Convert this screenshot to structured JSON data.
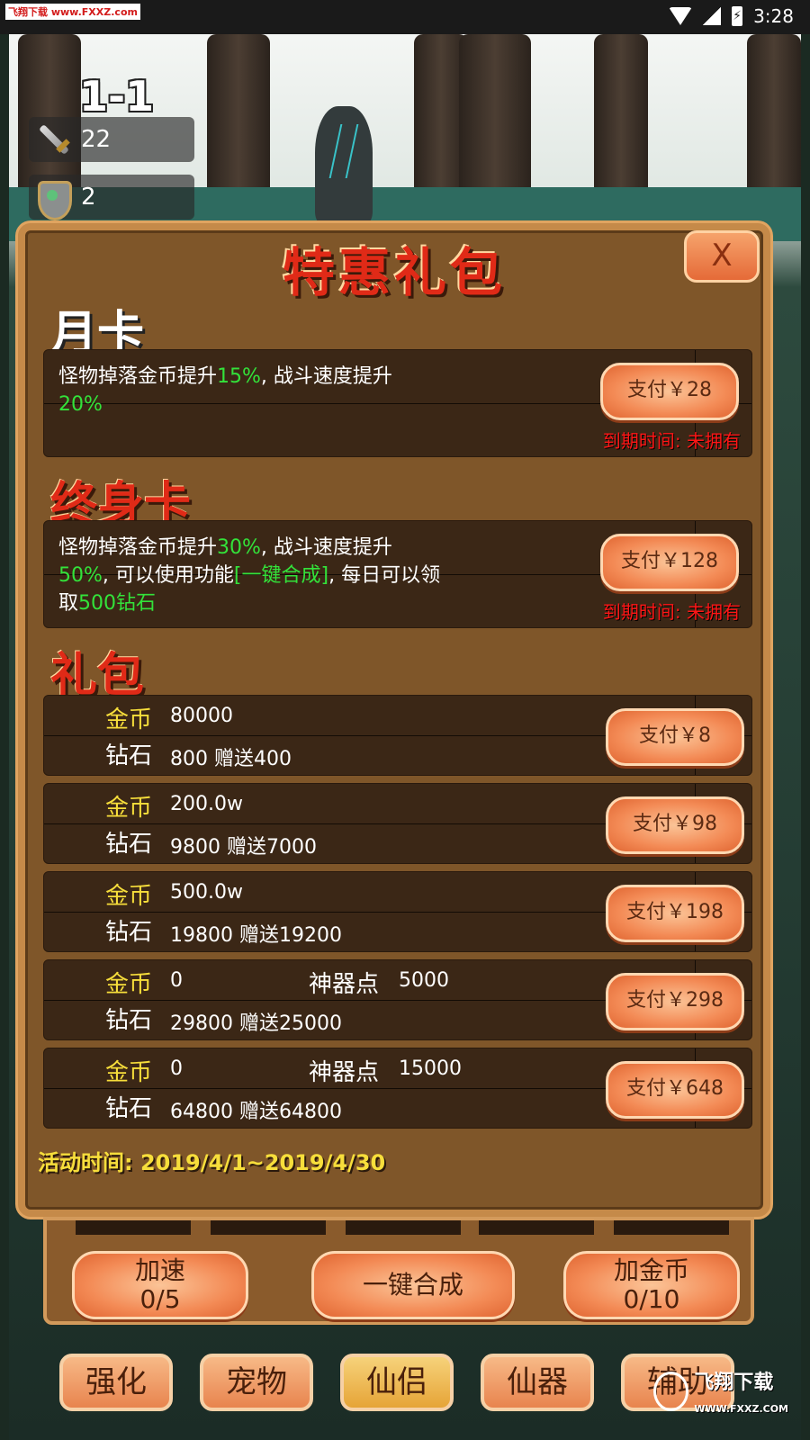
{
  "status_bar": {
    "watermark": "飞翔下载 www.FXXZ.com",
    "time": "3:28",
    "battery_glyph": "⚡"
  },
  "hud": {
    "level": "1-1",
    "attack": "22",
    "defense": "2"
  },
  "popup": {
    "title": "特惠礼包",
    "close_label": "X",
    "monthly": {
      "title": "月卡",
      "desc_parts": [
        "怪物掉落金币提升",
        "15%",
        ", 战斗速度提升",
        "20%"
      ],
      "pay_label": "支付￥28",
      "expire": "到期时间: 未拥有"
    },
    "lifetime": {
      "title": "终身卡",
      "desc_parts": [
        "怪物掉落金币提升",
        "30%",
        ", 战斗速度提升",
        "50%",
        ", 可以使用功能",
        "[一键合成]",
        ", 每日可以领取",
        "500钻石"
      ],
      "pay_label": "支付￥128",
      "expire": "到期时间: 未拥有"
    },
    "packs_title": "礼包",
    "labels": {
      "gold": "金币",
      "diamond": "钻石",
      "artifact": "神器点"
    },
    "packs": [
      {
        "gold": "80000",
        "diamond": "800 赠送400",
        "artifact": "",
        "pay_label": "支付￥8"
      },
      {
        "gold": "200.0w",
        "diamond": "9800 赠送7000",
        "artifact": "",
        "pay_label": "支付￥98"
      },
      {
        "gold": "500.0w",
        "diamond": "19800 赠送19200",
        "artifact": "",
        "pay_label": "支付￥198"
      },
      {
        "gold": "0",
        "diamond": "29800 赠送25000",
        "artifact": "5000",
        "pay_label": "支付￥298"
      },
      {
        "gold": "0",
        "diamond": "64800 赠送64800",
        "artifact": "15000",
        "pay_label": "支付￥648"
      }
    ],
    "activity_time": "活动时间: 2019/4/1~2019/4/30"
  },
  "actions": {
    "speed_label": "加速",
    "speed_count": "0/5",
    "merge_label": "一键合成",
    "gold_label": "加金币",
    "gold_count": "0/10"
  },
  "tabs": [
    {
      "label": "强化"
    },
    {
      "label": "宠物"
    },
    {
      "label": "仙侣"
    },
    {
      "label": "仙器"
    },
    {
      "label": "辅助"
    }
  ],
  "logo": {
    "text": "飞翔下载",
    "sub": "WWW.FXXZ.COM"
  },
  "colors": {
    "highlight_green": "#33e23a",
    "title_red": "#e02a17",
    "gold_yellow": "#f7de3b",
    "expire_red": "#ff1616"
  }
}
